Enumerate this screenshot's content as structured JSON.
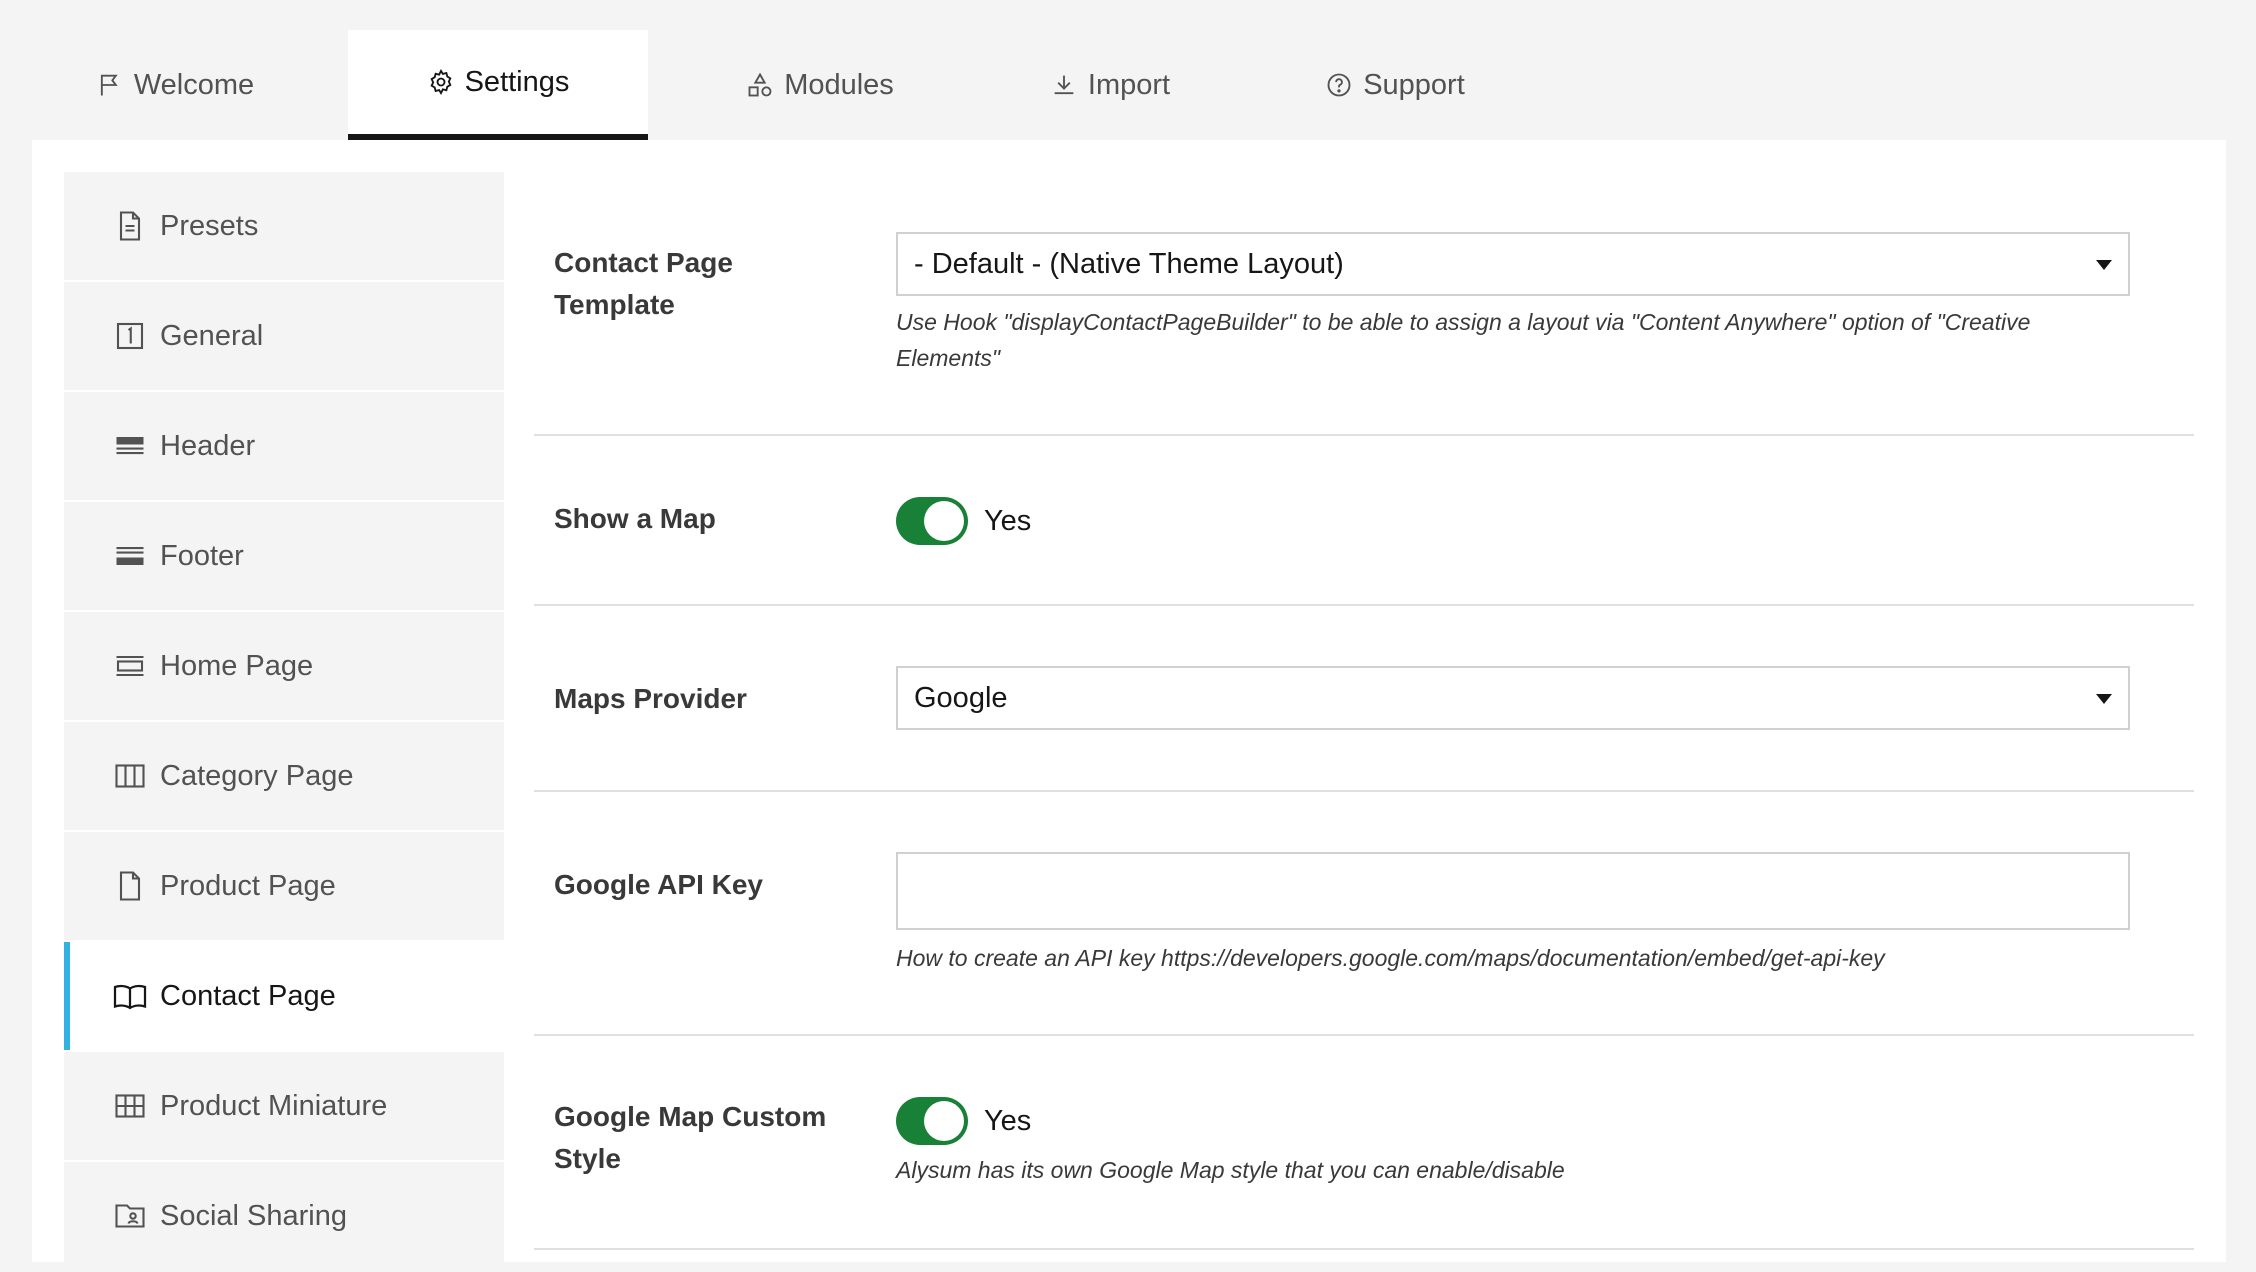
{
  "tabs": [
    {
      "label": "Welcome",
      "icon": "flag-icon",
      "active": false
    },
    {
      "label": "Settings",
      "icon": "gear-icon",
      "active": true
    },
    {
      "label": "Modules",
      "icon": "shapes-icon",
      "active": false
    },
    {
      "label": "Import",
      "icon": "download-icon",
      "active": false
    },
    {
      "label": "Support",
      "icon": "help-circle-icon",
      "active": false
    }
  ],
  "sidebar": {
    "items": [
      {
        "label": "Presets",
        "icon": "document-icon"
      },
      {
        "label": "General",
        "icon": "number-one-icon"
      },
      {
        "label": "Header",
        "icon": "header-icon"
      },
      {
        "label": "Footer",
        "icon": "footer-icon"
      },
      {
        "label": "Home Page",
        "icon": "home-layout-icon"
      },
      {
        "label": "Category Page",
        "icon": "columns-icon"
      },
      {
        "label": "Product Page",
        "icon": "page-icon"
      },
      {
        "label": "Contact Page",
        "icon": "book-icon",
        "active": true
      },
      {
        "label": "Product Miniature",
        "icon": "grid-icon"
      },
      {
        "label": "Social Sharing",
        "icon": "folder-user-icon"
      }
    ],
    "accent_color": "#33b1e0"
  },
  "form": {
    "contact_template": {
      "label": "Contact Page Template",
      "value": "- Default - (Native Theme Layout)",
      "help": "Use Hook \"displayContactPageBuilder\" to be able to assign a layout via \"Content Anywhere\" option of \"Creative Elements\""
    },
    "show_map": {
      "label": "Show a Map",
      "value": "Yes"
    },
    "maps_provider": {
      "label": "Maps Provider",
      "value": "Google"
    },
    "api_key": {
      "label": "Google API Key",
      "value": "",
      "help": "How to create an API key https://developers.google.com/maps/documentation/embed/get-api-key"
    },
    "custom_style": {
      "label": "Google Map Custom Style",
      "value": "Yes",
      "help": "Alysum has its own Google Map style that you can enable/disable"
    },
    "toggle_color": "#198038"
  }
}
